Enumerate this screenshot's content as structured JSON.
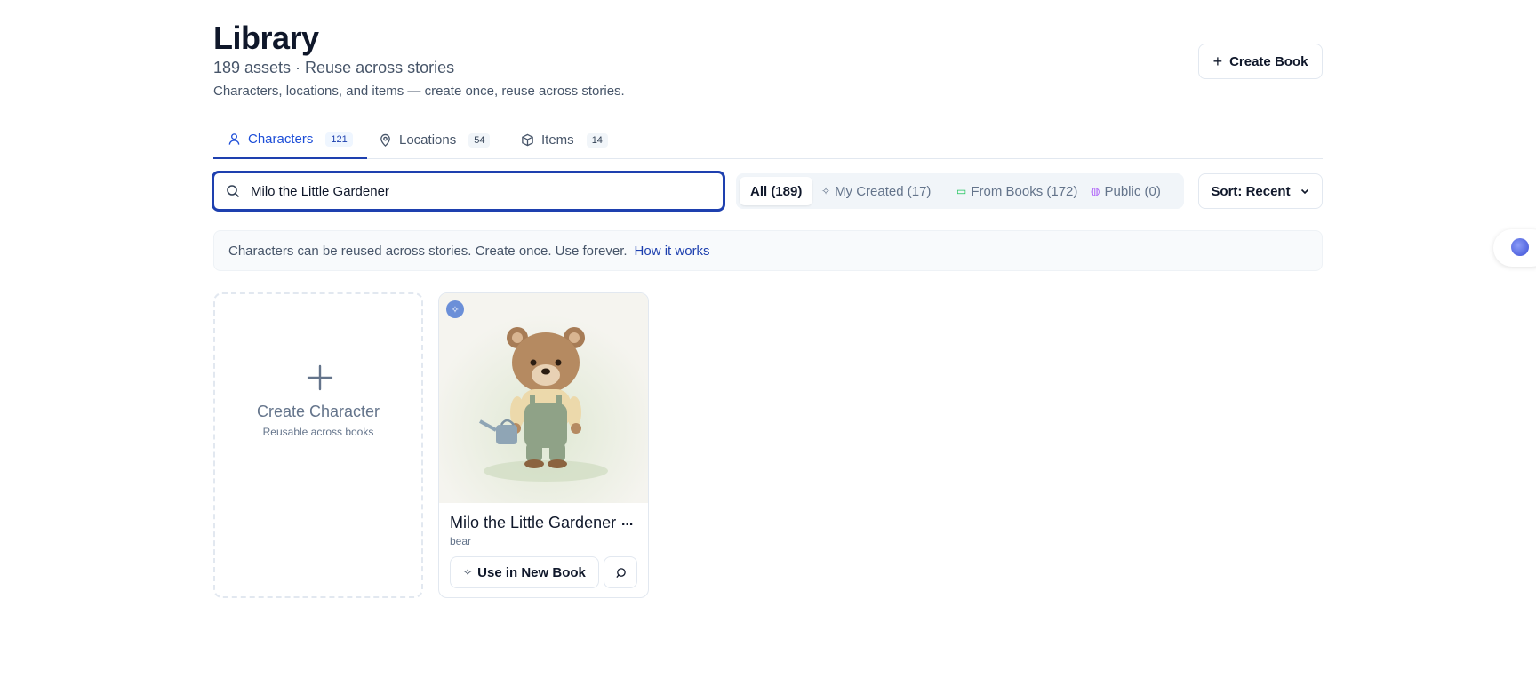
{
  "header": {
    "title": "Library",
    "subtitle": "189 assets · Reuse across stories",
    "description": "Characters, locations, and items — create once, reuse across stories.",
    "create_book_label": "Create Book"
  },
  "tabs": [
    {
      "label": "Characters",
      "count": "121",
      "icon": "user-icon",
      "active": true
    },
    {
      "label": "Locations",
      "count": "54",
      "icon": "map-pin-icon",
      "active": false
    },
    {
      "label": "Items",
      "count": "14",
      "icon": "package-icon",
      "active": false
    }
  ],
  "search": {
    "value": "Milo the Little Gardener",
    "placeholder": "Search..."
  },
  "filters": [
    {
      "label": "All (189)",
      "icon": "",
      "active": true
    },
    {
      "label": "My Created (17)",
      "icon": "sparkle-icon",
      "active": false
    },
    {
      "label": "From Books (172)",
      "icon": "book-icon",
      "active": false
    },
    {
      "label": "Public (0)",
      "icon": "globe-icon",
      "active": false
    }
  ],
  "sort": {
    "label": "Sort: Recent"
  },
  "info": {
    "text": "Characters can be reused across stories. Create once. Use forever.",
    "link": "How it works"
  },
  "create_card": {
    "title": "Create Character",
    "subtitle": "Reusable across books"
  },
  "characters": [
    {
      "name": "Milo the Little Gardener",
      "type": "bear",
      "more_label": "...",
      "use_label": "Use in New Book"
    }
  ],
  "colors": {
    "accent": "#1e40af",
    "border": "#e2e8f0",
    "muted_text": "#64748b"
  }
}
